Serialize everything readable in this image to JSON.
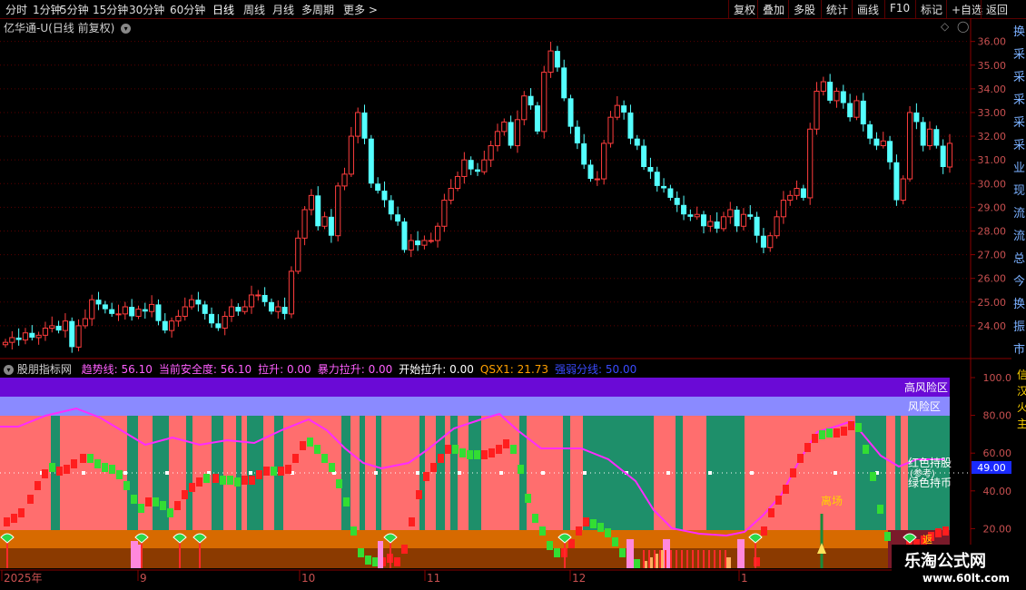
{
  "toolbar": {
    "periods": [
      "分时",
      "1分钟",
      "5分钟",
      "15分钟",
      "30分钟",
      "60分钟",
      "日线",
      "周线",
      "月线",
      "多周期",
      "更多 >"
    ],
    "active_period": "日线",
    "right_buttons": [
      "复权",
      "叠加",
      "多股",
      "统计",
      "画线",
      "F10",
      "标记",
      "+自选",
      "返回"
    ]
  },
  "main_chart": {
    "title": "亿华通-U(日线 前复权)",
    "price_ticks": [
      "36.00",
      "35.00",
      "34.00",
      "33.00",
      "32.00",
      "31.00",
      "30.00",
      "29.00",
      "28.00",
      "27.00",
      "26.00",
      "25.00",
      "24.00"
    ],
    "price_range": [
      23.0,
      36.6
    ],
    "side_text": [
      "换",
      "采",
      "采",
      "采",
      "采",
      "采",
      "业",
      "现",
      "流",
      "流",
      "总",
      "今",
      "换",
      "振",
      "市"
    ]
  },
  "indicator": {
    "name": "股朋指标网",
    "values": [
      {
        "label": "趋势线:",
        "value": "56.10",
        "color": "#ff5fff"
      },
      {
        "label": "当前安全度:",
        "value": "56.10",
        "color": "#ff5fff"
      },
      {
        "label": "拉升:",
        "value": "0.00",
        "color": "#ff5fff"
      },
      {
        "label": "暴力拉升:",
        "value": "0.00",
        "color": "#ff5fff"
      },
      {
        "label": "开始拉升:",
        "value": "0.00",
        "color": "#ffffff"
      },
      {
        "label": "QSX1:",
        "value": "21.73",
        "color": "#ffa000"
      },
      {
        "label": "强弱分线:",
        "value": "50.00",
        "color": "#3a4bff"
      }
    ],
    "zone_labels": {
      "high_risk": "高风险区",
      "risk": "风险区",
      "red_hold": "红色持股",
      "green_hold": "绿色持币",
      "hold_note": "(参考)",
      "exit": "离场",
      "bottom_note": "返"
    },
    "axis_ticks": [
      "100.0",
      "80.00",
      "60.00",
      "40.00",
      "20.00"
    ],
    "current_value_badge": "49.00",
    "side_text": [
      "信",
      "汉",
      "火",
      "主"
    ]
  },
  "date_axis": {
    "labels": [
      "2025年",
      "9",
      "10",
      "11",
      "12",
      "1"
    ]
  },
  "watermark": {
    "line1": "乐淘公式网",
    "line2": "www.60lt.com"
  },
  "colors": {
    "up": "#ff3d3d",
    "down": "#54ffff",
    "grid": "#5a0000",
    "trend": "#ff2bff",
    "risk_pink": "#ff6e6e",
    "risk_green": "#1e8f6a",
    "high_risk": "#6a0ad6",
    "risk_band": "#8a8aff",
    "bottom_orange": "#d76a00",
    "bottom_brown": "#8b3a00"
  },
  "chart_data": {
    "type": "candlestick",
    "title": "",
    "ylim": [
      23.0,
      36.6
    ],
    "close": [
      23.3,
      23.5,
      23.4,
      23.7,
      23.5,
      23.6,
      23.9,
      24.0,
      23.8,
      24.2,
      23.1,
      24.0,
      24.3,
      25.1,
      24.9,
      24.7,
      24.5,
      24.5,
      24.8,
      24.4,
      24.7,
      24.6,
      24.9,
      24.2,
      23.8,
      24.2,
      24.4,
      24.8,
      25.1,
      24.9,
      24.5,
      24.1,
      23.9,
      24.4,
      24.8,
      24.6,
      24.8,
      25.3,
      25.3,
      25.0,
      24.6,
      24.8,
      24.5,
      26.3,
      27.7,
      28.9,
      29.5,
      28.2,
      28.6,
      27.8,
      29.9,
      30.4,
      32.0,
      33.0,
      31.9,
      30.0,
      29.7,
      29.3,
      28.7,
      28.4,
      27.2,
      27.6,
      27.4,
      27.6,
      27.6,
      28.2,
      29.3,
      29.8,
      30.3,
      31.0,
      30.6,
      30.5,
      31.0,
      31.6,
      32.2,
      32.6,
      31.6,
      32.7,
      33.7,
      33.3,
      32.2,
      34.7,
      35.6,
      34.9,
      33.6,
      32.4,
      31.7,
      30.8,
      30.2,
      30.2,
      31.7,
      32.8,
      33.3,
      33.0,
      31.9,
      31.6,
      30.7,
      30.5,
      29.9,
      29.8,
      29.4,
      29.1,
      28.7,
      28.6,
      28.7,
      28.2,
      28.4,
      28.1,
      28.6,
      28.9,
      28.2,
      28.7,
      28.6,
      27.8,
      27.3,
      27.8,
      28.6,
      29.3,
      29.5,
      29.8,
      29.4,
      32.3,
      33.9,
      34.3,
      33.5,
      33.9,
      33.4,
      32.8,
      33.5,
      32.5,
      31.9,
      31.6,
      31.8,
      30.9,
      29.3,
      30.2,
      33.0,
      32.6,
      31.6,
      32.3,
      31.6,
      30.7,
      31.7
    ]
  }
}
